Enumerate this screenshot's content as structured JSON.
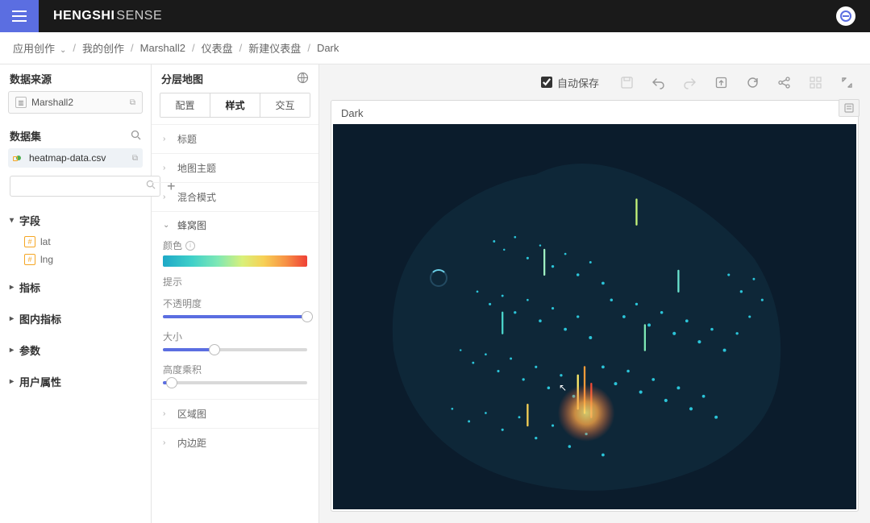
{
  "brand": {
    "bold": "HENGSHI",
    "light": "SENSE"
  },
  "breadcrumbs": {
    "root": "应用创作",
    "items": [
      "我的创作",
      "Marshall2",
      "仪表盘",
      "新建仪表盘",
      "Dark"
    ]
  },
  "left": {
    "data_source_label": "数据来源",
    "data_source_item": "Marshall2",
    "dataset_label": "数据集",
    "dataset_item": "heatmap-data.csv",
    "search_placeholder": "",
    "sections": {
      "fields": "字段",
      "metrics": "指标",
      "chart_metrics": "图内指标",
      "params": "参数",
      "user_attrs": "用户属性"
    },
    "field_items": [
      "lat",
      "lng"
    ]
  },
  "mid": {
    "title": "分层地图",
    "tabs": {
      "config": "配置",
      "style": "样式",
      "interact": "交互"
    },
    "rows": {
      "title": "标题",
      "theme": "地图主题",
      "blend": "混合模式",
      "hex": "蜂窝图",
      "region": "区域图",
      "padding": "内边距"
    },
    "hex_group": {
      "color": "颜色",
      "hint": "提示",
      "opacity": "不透明度",
      "size": "大小",
      "height_mul": "高度乘积"
    },
    "sliders": {
      "opacity_pct": 100,
      "size_pct": 36,
      "height_pct": 6
    }
  },
  "toolbar": {
    "autosave": "自动保存"
  },
  "canvas": {
    "title": "Dark"
  }
}
